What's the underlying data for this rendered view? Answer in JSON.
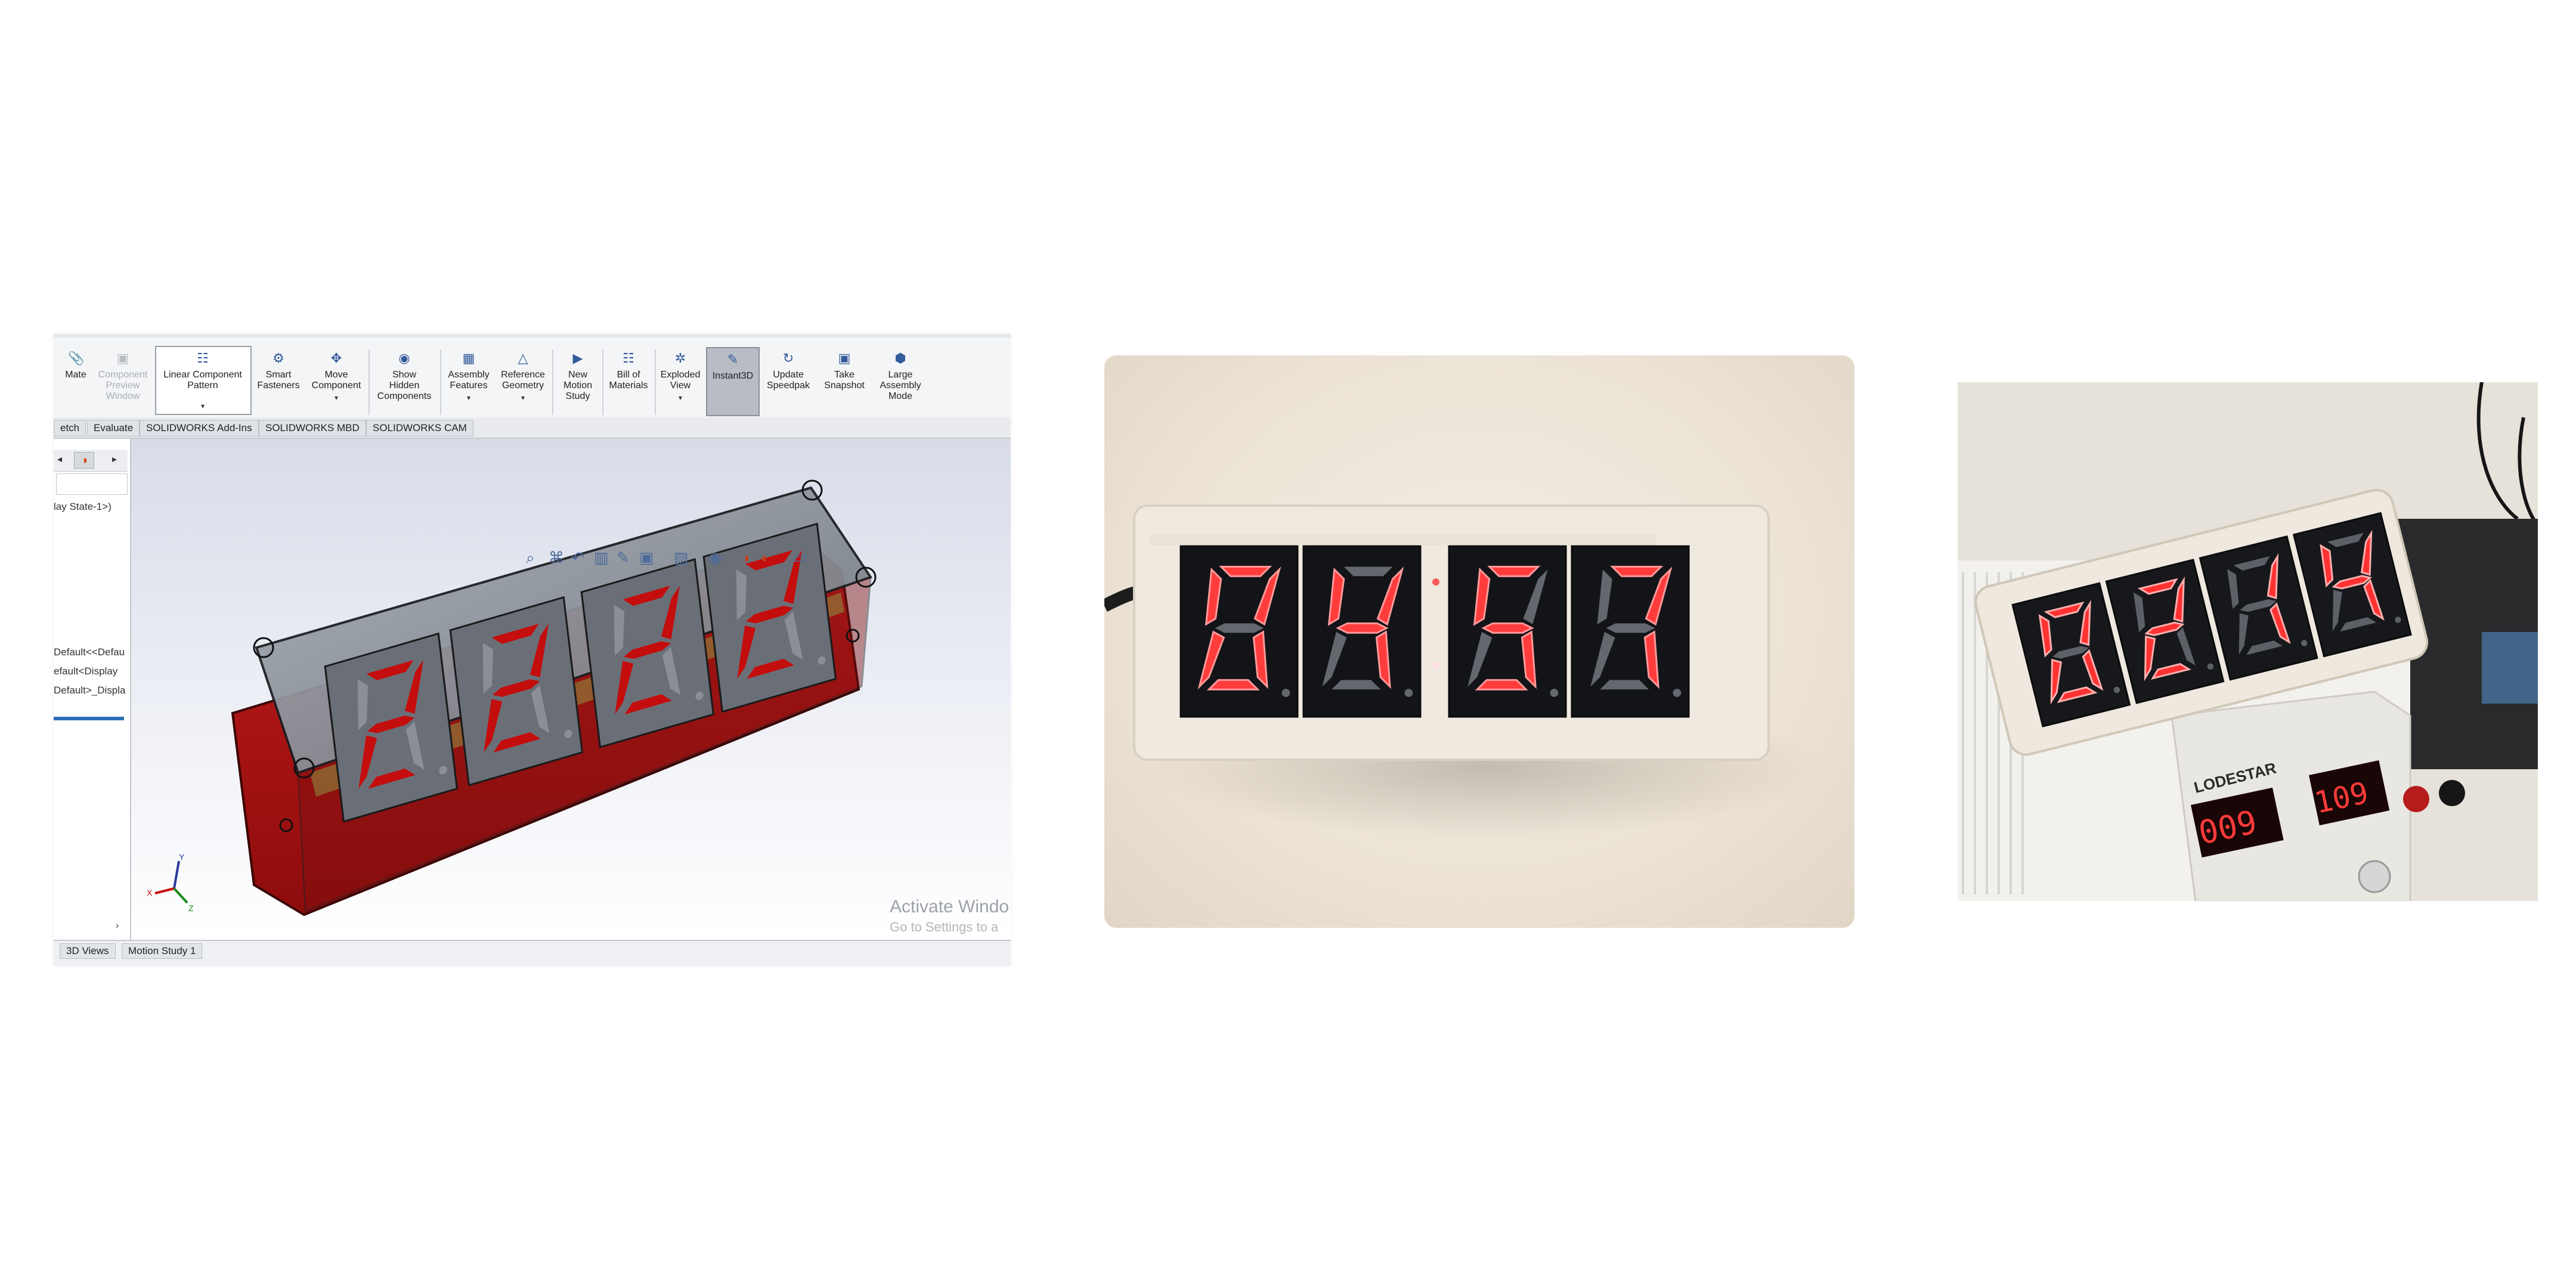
{
  "toolbar": {
    "buttons": [
      {
        "label": "Mate",
        "icon": "mate-icon"
      },
      {
        "label": "Component\nPreview\nWindow",
        "icon": "component-preview-icon"
      },
      {
        "label": "Linear Component\nPattern",
        "icon": "linear-pattern-icon"
      },
      {
        "label": "Smart\nFasteners",
        "icon": "smart-fasteners-icon"
      },
      {
        "label": "Move\nComponent",
        "icon": "move-component-icon"
      },
      {
        "label": "Show\nHidden\nComponents",
        "icon": "show-hidden-icon"
      },
      {
        "label": "Assembly\nFeatures",
        "icon": "assembly-features-icon"
      },
      {
        "label": "Reference\nGeometry",
        "icon": "reference-geometry-icon"
      },
      {
        "label": "New\nMotion\nStudy",
        "icon": "motion-study-icon"
      },
      {
        "label": "Bill of\nMaterials",
        "icon": "bom-icon"
      },
      {
        "label": "Exploded\nView",
        "icon": "exploded-view-icon"
      },
      {
        "label": "Instant3D",
        "icon": "instant3d-icon"
      },
      {
        "label": "Update\nSpeedpak",
        "icon": "speedpak-icon"
      },
      {
        "label": "Take\nSnapshot",
        "icon": "camera-icon"
      },
      {
        "label": "Large\nAssembly\nMode",
        "icon": "large-assembly-icon"
      }
    ]
  },
  "tabs": [
    "etch",
    "Evaluate",
    "SOLIDWORKS Add-Ins",
    "SOLIDWORKS MBD",
    "SOLIDWORKS CAM"
  ],
  "tree": {
    "item1": "lay State-1>)",
    "item2": "Default<<Defau",
    "item3": "efault<Display",
    "item4": "Default>_Displa"
  },
  "bottom_tabs": [
    "3D Views",
    "Motion Study 1"
  ],
  "watermark": {
    "line1": "Activate Windo",
    "line2": "Go to Settings to a"
  },
  "triad": {
    "x": "X",
    "y": "Y",
    "z": "Z"
  },
  "cad_display": [
    "2",
    "2",
    "2",
    "2"
  ],
  "photo2_display": [
    "0",
    "4",
    "5",
    "7"
  ],
  "photo3_display": [
    "0",
    "2",
    "1",
    "4"
  ],
  "psu": {
    "brand": "LODESTAR",
    "v": "009",
    "a": "109"
  },
  "colors": {
    "segment_on": "#ff2a2a",
    "segment_off": "#5a5e66",
    "cad_red": "#c40d0d",
    "case": "#ece7de"
  }
}
